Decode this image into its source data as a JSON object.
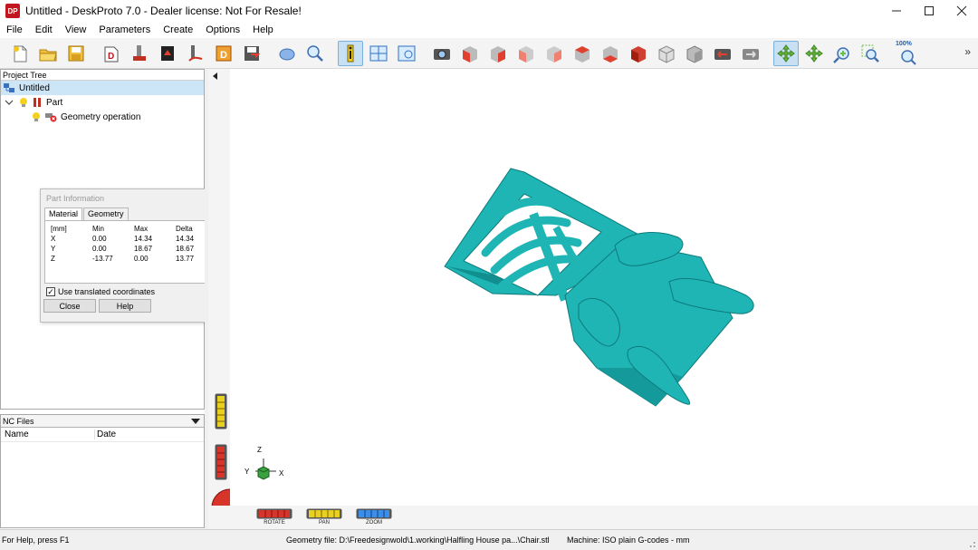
{
  "window": {
    "title": "Untitled - DeskProto 7.0 - Dealer license: Not For Resale!",
    "app_icon_text": "DP",
    "controls": [
      "minimize-icon",
      "maximize-icon",
      "close-icon"
    ]
  },
  "menu": [
    "File",
    "Edit",
    "View",
    "Parameters",
    "Create",
    "Options",
    "Help"
  ],
  "toolbar": {
    "buttons": [
      "new-icon",
      "open-icon",
      "save-icon",
      "create-project-icon",
      "mill-part-icon",
      "send-to-machine-icon",
      "toolpath-icon",
      "export-icon",
      "save-nc-icon",
      "select-icon",
      "zoom-fit-icon",
      "info-icon",
      "views-icon",
      "frame-icon",
      "camera-icon",
      "view-front-icon",
      "view-back-icon",
      "view-left-icon",
      "view-right-icon",
      "view-top-icon",
      "view-bottom-icon",
      "view-iso-icon",
      "view-iso2-icon",
      "previous-view-icon",
      "next-view-icon",
      "rotate-icon",
      "pan-icon",
      "zoom-icon",
      "zoom-window-icon",
      "zoom-100-icon"
    ],
    "zoom_100_label": "100%",
    "more_glyph": "»",
    "accent": "#2d9cdb"
  },
  "project_tree": {
    "header": "Project Tree",
    "items": [
      {
        "label": "Untitled",
        "level": 0
      },
      {
        "label": "Part",
        "level": 1
      },
      {
        "label": "Geometry operation",
        "level": 2
      }
    ]
  },
  "part_info": {
    "title": "Part Information",
    "tabs": [
      "Material",
      "Geometry"
    ],
    "active_tab": "Material",
    "headers": [
      "[mm]",
      "Min",
      "Max",
      "Delta"
    ],
    "rows": [
      [
        "X",
        "0.00",
        "14.34",
        "14.34"
      ],
      [
        "Y",
        "0.00",
        "18.67",
        "18.67"
      ],
      [
        "Z",
        "-13.77",
        "0.00",
        "13.77"
      ]
    ],
    "checkbox_label": "Use translated coordinates",
    "checkbox_checked": true,
    "close_label": "Close",
    "help_label": "Help"
  },
  "nc_files": {
    "header": "NC Files",
    "columns": [
      "Name",
      "Date"
    ]
  },
  "viewport": {
    "model_color": "#1fb5b5",
    "axis_labels": {
      "z": "Z",
      "y": "Y",
      "x": "X"
    },
    "controls": [
      {
        "name": "rotate",
        "label": "ROTATE",
        "color": "#d8352a"
      },
      {
        "name": "pan",
        "label": "PAN",
        "color": "#e8d020"
      },
      {
        "name": "zoom",
        "label": "ZOOM",
        "color": "#3a8ee8"
      }
    ]
  },
  "statusbar": {
    "help": "For Help, press F1",
    "geometry": "Geometry file: D:\\Freedesignwold\\1.working\\Halfling House pa...\\Chair.stl",
    "machine": "Machine: ISO plain G-codes - mm"
  }
}
